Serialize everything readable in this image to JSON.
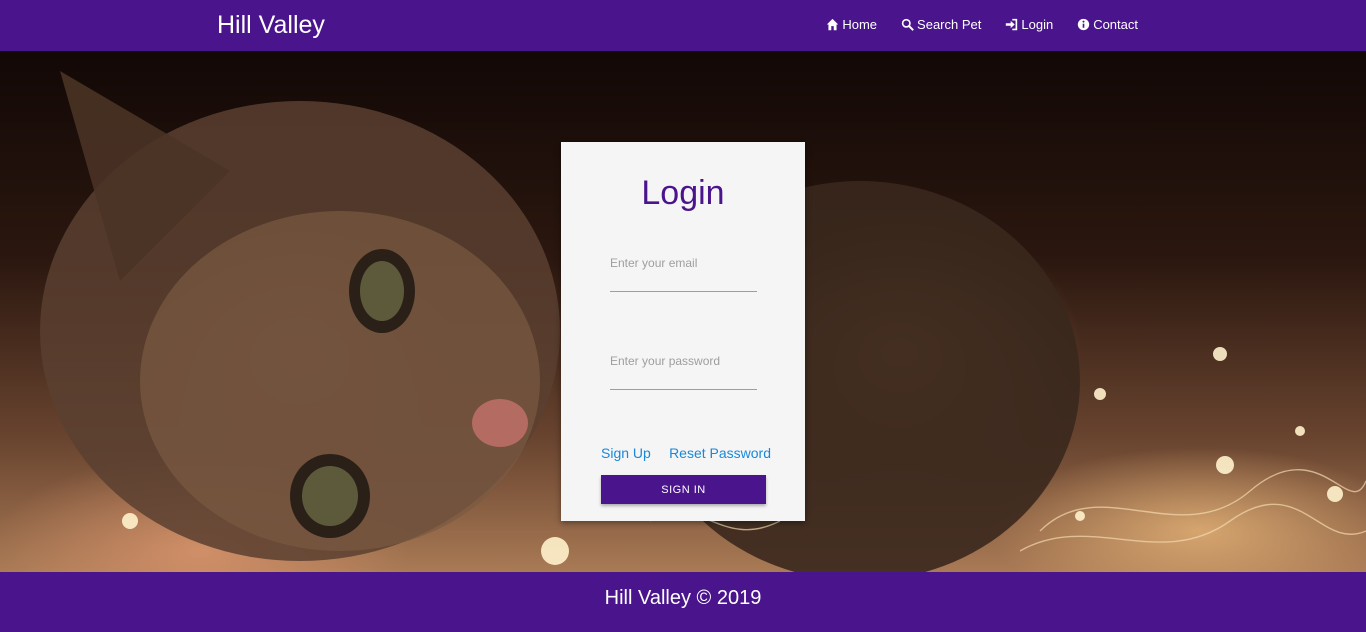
{
  "brand": "Hill Valley",
  "nav": [
    {
      "label": "Home",
      "icon": "home-icon"
    },
    {
      "label": "Search Pet",
      "icon": "search-icon"
    },
    {
      "label": "Login",
      "icon": "sign-in-icon"
    },
    {
      "label": "Contact",
      "icon": "info-icon"
    }
  ],
  "hero": {
    "image": "kitten-with-fairy-lights"
  },
  "login": {
    "title": "Login",
    "email_placeholder": "Enter your email",
    "password_placeholder": "Enter your password",
    "signup_label": "Sign Up",
    "reset_label": "Reset Password",
    "signin_label": "SIGN IN"
  },
  "footer": {
    "text": "Hill Valley © 2019"
  },
  "colors": {
    "primary": "#4a148c",
    "link": "#1a88d8",
    "card": "#f5f5f5"
  }
}
